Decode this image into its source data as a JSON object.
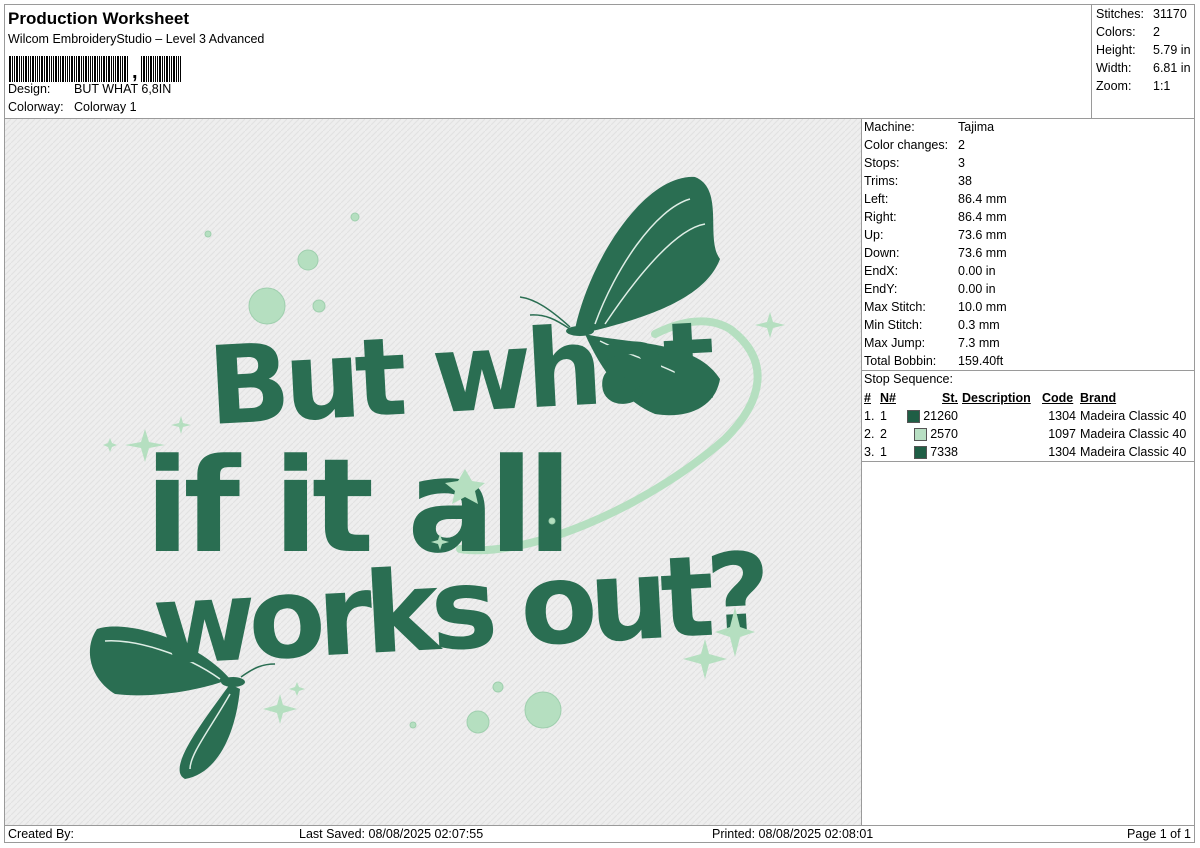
{
  "header": {
    "title": "Production Worksheet",
    "subtitle": "Wilcom EmbroideryStudio – Level 3 Advanced",
    "design_label": "Design:",
    "design_value": "BUT WHAT 6,8IN",
    "colorway_label": "Colorway:",
    "colorway_value": "Colorway 1"
  },
  "stats": {
    "stitches_label": "Stitches:",
    "stitches": "31170",
    "colors_label": "Colors:",
    "colors": "2",
    "height_label": "Height:",
    "height": "5.79 in",
    "width_label": "Width:",
    "width": "6.81 in",
    "zoom_label": "Zoom:",
    "zoom": "1:1"
  },
  "machine": {
    "machine_label": "Machine:",
    "machine": "Tajima",
    "color_changes_label": "Color changes:",
    "color_changes": "2",
    "stops_label": "Stops:",
    "stops": "3",
    "trims_label": "Trims:",
    "trims": "38",
    "left_label": "Left:",
    "left": "86.4 mm",
    "right_label": "Right:",
    "right": "86.4 mm",
    "up_label": "Up:",
    "up": "73.6 mm",
    "down_label": "Down:",
    "down": "73.6 mm",
    "endx_label": "EndX:",
    "endx": "0.00 in",
    "endy_label": "EndY:",
    "endy": "0.00 in",
    "max_stitch_label": "Max Stitch:",
    "max_stitch": "10.0 mm",
    "min_stitch_label": "Min Stitch:",
    "min_stitch": "0.3 mm",
    "max_jump_label": "Max Jump:",
    "max_jump": "7.3 mm",
    "total_bobbin_label": "Total Bobbin:",
    "total_bobbin": "159.40ft"
  },
  "stop_sequence": {
    "heading": "Stop Sequence:",
    "columns": [
      "#",
      "N#",
      "St.",
      "Description",
      "Code",
      "Brand"
    ],
    "rows": [
      {
        "idx": "1.",
        "n": "1",
        "color": "#1f5e45",
        "st": "21260",
        "desc": "",
        "code": "1304",
        "brand": "Madeira Classic 40"
      },
      {
        "idx": "2.",
        "n": "2",
        "color": "#b8dfc3",
        "st": "2570",
        "desc": "",
        "code": "1097",
        "brand": "Madeira Classic 40"
      },
      {
        "idx": "3.",
        "n": "1",
        "color": "#1f5e45",
        "st": "7338",
        "desc": "",
        "code": "1304",
        "brand": "Madeira Classic 40"
      }
    ]
  },
  "design": {
    "line1": "But what",
    "line2": "if it all",
    "line3": "works out?",
    "thread_dark": "#2a6e52",
    "thread_light": "#b5dfc0",
    "fabric": "#eeeeee"
  },
  "footer": {
    "created_by": "Created By:",
    "last_saved": "Last Saved: 08/08/2025 02:07:55",
    "printed": "Printed: 08/08/2025 02:08:01",
    "page": "Page 1 of 1"
  }
}
